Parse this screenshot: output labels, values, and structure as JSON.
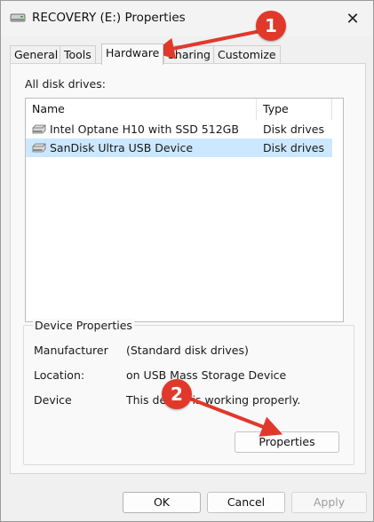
{
  "window": {
    "title": "RECOVERY (E:) Properties",
    "close_glyph": "✕"
  },
  "tabs": [
    {
      "label": "General"
    },
    {
      "label": "Tools"
    },
    {
      "label": "Hardware",
      "active": true
    },
    {
      "label": "Sharing"
    },
    {
      "label": "Customize"
    }
  ],
  "hardware": {
    "all_disks_label": "All disk drives:",
    "columns": {
      "name": "Name",
      "type": "Type"
    },
    "drives": [
      {
        "name": "Intel Optane H10 with SSD 512GB",
        "type": "Disk drives",
        "selected": false
      },
      {
        "name": "SanDisk Ultra USB Device",
        "type": "Disk drives",
        "selected": true
      }
    ],
    "device_properties": {
      "title": "Device Properties",
      "manufacturer_label": "Manufacturer",
      "manufacturer_value": "(Standard disk drives)",
      "location_label": "Location:",
      "location_value": "on USB Mass Storage Device",
      "status_label": "Device",
      "status_value": "This device is working properly.",
      "properties_button": "Properties"
    }
  },
  "footer": {
    "ok": "OK",
    "cancel": "Cancel",
    "apply": "Apply"
  },
  "annotations": [
    {
      "number": "1"
    },
    {
      "number": "2"
    }
  ],
  "colors": {
    "selection": "#cce8ff",
    "annotation_red": "#e0392c"
  }
}
